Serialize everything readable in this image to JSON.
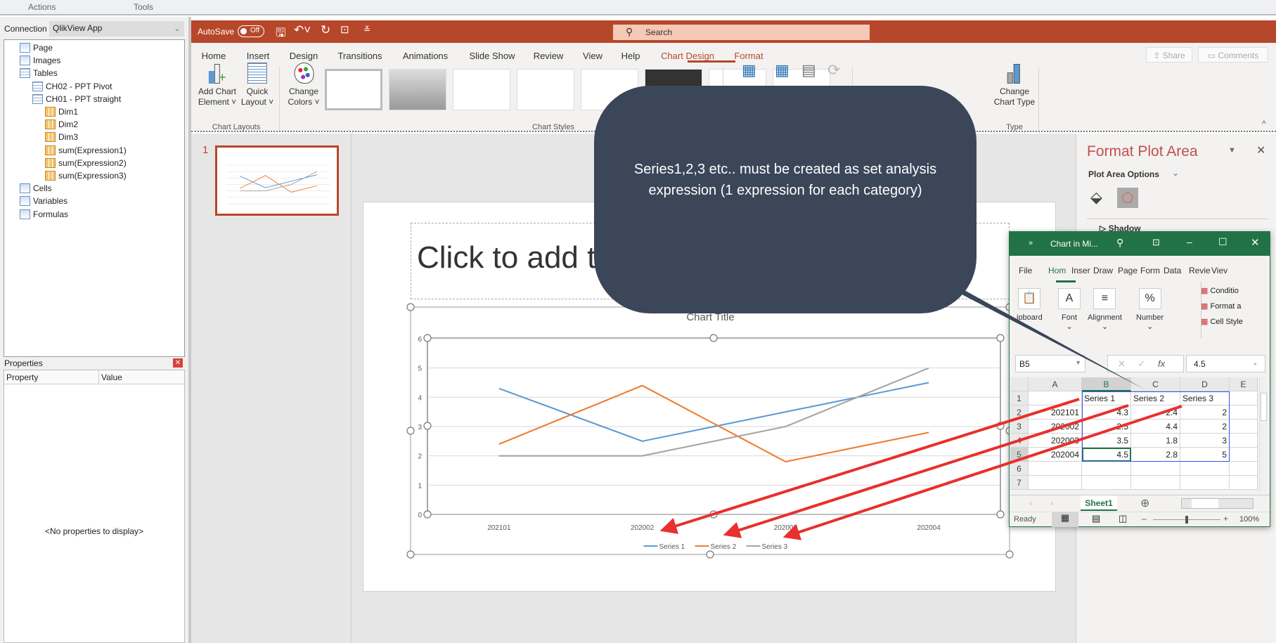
{
  "qlik": {
    "top_tabs": [
      "Actions",
      "Tools"
    ],
    "connection_label": "Connection",
    "connection_value": "QlikView App",
    "tree": [
      {
        "label": "Page",
        "level": 0,
        "icon": "page-icon"
      },
      {
        "label": "Images",
        "level": 0,
        "icon": "images-icon"
      },
      {
        "label": "Tables",
        "level": 0,
        "icon": "tables-icon"
      },
      {
        "label": "CH02 - PPT Pivot",
        "level": 1,
        "icon": "table-icon"
      },
      {
        "label": "CH01 - PPT straight",
        "level": 1,
        "icon": "table-icon"
      },
      {
        "label": "Dim1",
        "level": 2,
        "icon": "column-icon"
      },
      {
        "label": "Dim2",
        "level": 2,
        "icon": "column-icon"
      },
      {
        "label": "Dim3",
        "level": 2,
        "icon": "column-icon"
      },
      {
        "label": "sum(Expression1)",
        "level": 2,
        "icon": "column-icon"
      },
      {
        "label": "sum(Expression2)",
        "level": 2,
        "icon": "column-icon"
      },
      {
        "label": "sum(Expression3)",
        "level": 2,
        "icon": "column-icon"
      },
      {
        "label": "Cells",
        "level": 0,
        "icon": "cells-icon"
      },
      {
        "label": "Variables",
        "level": 0,
        "icon": "omega-icon"
      },
      {
        "label": "Formulas",
        "level": 0,
        "icon": "fx-icon"
      }
    ],
    "properties": {
      "title": "Properties",
      "col_property": "Property",
      "col_value": "Value",
      "empty": "<No properties to display>"
    }
  },
  "ppt": {
    "autosave": "AutoSave",
    "autosave_state": "Off",
    "search_placeholder": "Search",
    "tabs": [
      "Home",
      "Insert",
      "Design",
      "Transitions",
      "Animations",
      "Slide Show",
      "Review",
      "View",
      "Help",
      "Chart Design",
      "Format"
    ],
    "share": "Share",
    "comments": "Comments",
    "ribbon": {
      "add_chart_element": [
        "Add Chart",
        "Element ˅"
      ],
      "quick_layout": [
        "Quick",
        "Layout ˅"
      ],
      "change_colors": [
        "Change",
        "Colors ˅"
      ],
      "change_chart_type": [
        "Change",
        "Chart Type"
      ],
      "groups": [
        "Chart Layouts",
        "Chart Styles",
        "Type"
      ]
    },
    "slide_number": "1",
    "title_placeholder": "Click to add title",
    "format_pane": {
      "title": "Format Plot Area",
      "options": "Plot Area Options",
      "section": "Shadow"
    }
  },
  "chart_data": {
    "type": "line",
    "title": "Chart Title",
    "categories": [
      "202101",
      "202002",
      "202003",
      "202004"
    ],
    "series": [
      {
        "name": "Series 1",
        "values": [
          4.3,
          2.5,
          3.5,
          4.5
        ],
        "color": "#5b9bd5"
      },
      {
        "name": "Series 2",
        "values": [
          2.4,
          4.4,
          1.8,
          2.8
        ],
        "color": "#ed7d31"
      },
      {
        "name": "Series 3",
        "values": [
          2,
          2,
          3,
          5
        ],
        "color": "#a5a5a5"
      }
    ],
    "ylim": [
      0,
      6
    ],
    "yticks": [
      "0",
      "1",
      "2",
      "3",
      "4",
      "5",
      "6"
    ],
    "grid": true,
    "legend": "bottom"
  },
  "excel": {
    "title": "Chart in Mi...",
    "tabs": [
      "File",
      "Hom",
      "Inser",
      "Draw",
      "Page",
      "Form",
      "Data",
      "Revie",
      "Viev"
    ],
    "groups": [
      "ipboard",
      "Font",
      "Alignment",
      "Number"
    ],
    "styles": [
      "Conditio",
      "Format a",
      "Cell Style"
    ],
    "name_box": "B5",
    "formula": "4.5",
    "columns": [
      "A",
      "B",
      "C",
      "D",
      "E"
    ],
    "rows": [
      [
        "",
        "Series 1",
        "Series 2",
        "Series 3"
      ],
      [
        "202101",
        "4.3",
        "2.4",
        "2"
      ],
      [
        "202002",
        "2.5",
        "4.4",
        "2"
      ],
      [
        "202003",
        "3.5",
        "1.8",
        "3"
      ],
      [
        "202004",
        "4.5",
        "2.8",
        "5"
      ],
      [
        "",
        "",
        "",
        ""
      ],
      [
        "",
        "",
        "",
        ""
      ]
    ],
    "sheet": "Sheet1",
    "status": "Ready",
    "zoom": "100%"
  },
  "callout": {
    "text": "Series1,2,3 etc.. must be created as set analysis expression (1 expression for each category)"
  },
  "colors": {
    "ppt_accent": "#b7472a",
    "excel_accent": "#217346",
    "callout_bg": "#3b4659",
    "arrow": "#e8302e"
  }
}
